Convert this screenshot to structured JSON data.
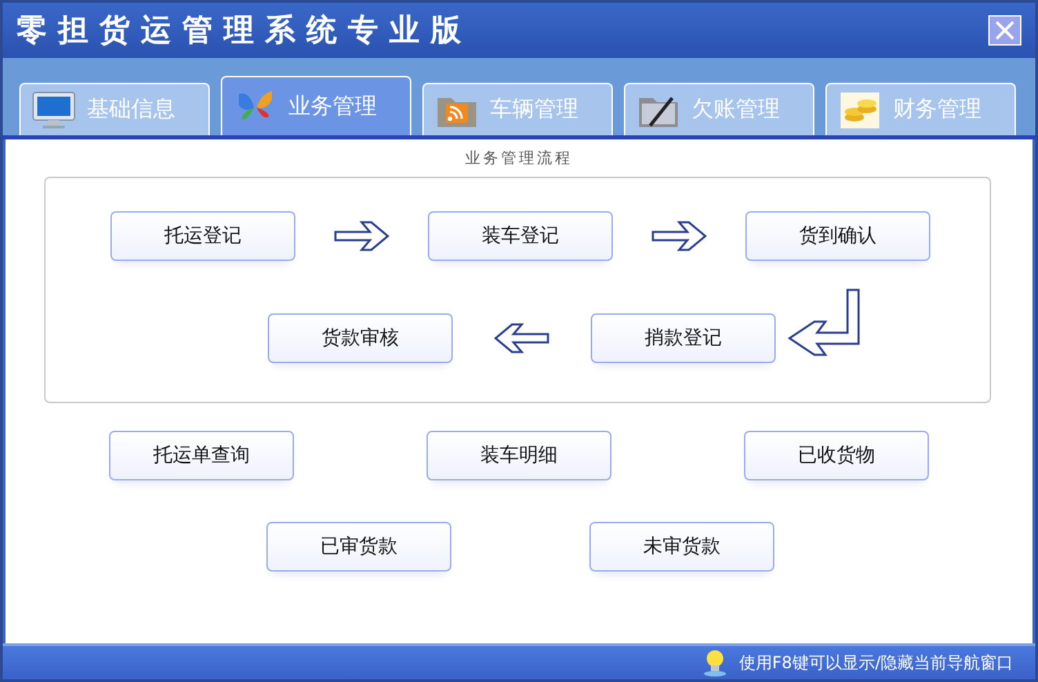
{
  "window": {
    "title": "零担货运管理系统专业版"
  },
  "tabs": [
    {
      "label": "基础信息",
      "selected": false
    },
    {
      "label": "业务管理",
      "selected": true
    },
    {
      "label": "车辆管理",
      "selected": false
    },
    {
      "label": "欠账管理",
      "selected": false
    },
    {
      "label": "财务管理",
      "selected": false
    }
  ],
  "flow": {
    "title": "业务管理流程",
    "row_1": [
      "托运登记",
      "装车登记",
      "货到确认"
    ],
    "row_2": [
      "货款审核",
      "捎款登记"
    ]
  },
  "shortcuts": {
    "row_1": [
      "托运单查询",
      "装车明细",
      "已收货物"
    ],
    "row_2": [
      "已审货款",
      "未审货款"
    ]
  },
  "status_bar": {
    "text": "使用F8键可以显示/隐藏当前导航窗口"
  }
}
